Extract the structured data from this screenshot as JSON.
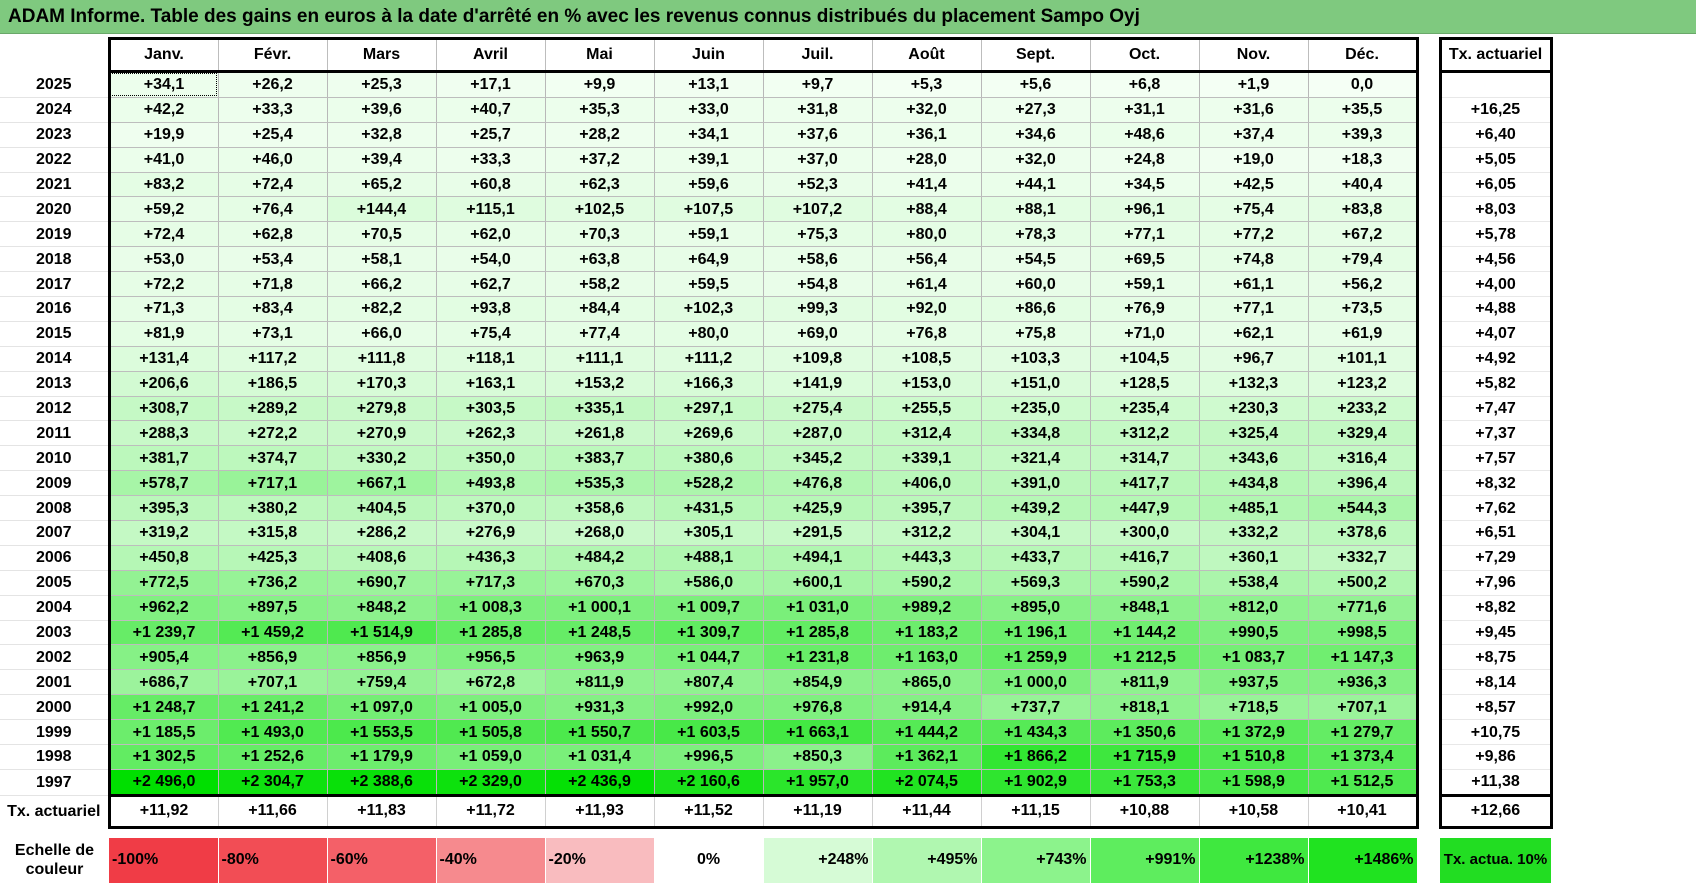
{
  "title": "ADAM Informe. Table des gains en euros à la date d'arrêté en % avec les revenus connus distribués du placement Sampo Oyj",
  "months": [
    "Janv.",
    "Févr.",
    "Mars",
    "Avril",
    "Mai",
    "Juin",
    "Juil.",
    "Août",
    "Sept.",
    "Oct.",
    "Nov.",
    "Déc."
  ],
  "actuarial_header": "Tx. actuariel",
  "rows": [
    {
      "year": "2025",
      "values": [
        "+34,1",
        "+26,2",
        "+25,3",
        "+17,1",
        "+9,9",
        "+13,1",
        "+9,7",
        "+5,3",
        "+5,6",
        "+6,8",
        "+1,9",
        "0,0"
      ],
      "rate": ""
    },
    {
      "year": "2024",
      "values": [
        "+42,2",
        "+33,3",
        "+39,6",
        "+40,7",
        "+35,3",
        "+33,0",
        "+31,8",
        "+32,0",
        "+27,3",
        "+31,1",
        "+31,6",
        "+35,5"
      ],
      "rate": "+16,25"
    },
    {
      "year": "2023",
      "values": [
        "+19,9",
        "+25,4",
        "+32,8",
        "+25,7",
        "+28,2",
        "+34,1",
        "+37,6",
        "+36,1",
        "+34,6",
        "+48,6",
        "+37,4",
        "+39,3"
      ],
      "rate": "+6,40"
    },
    {
      "year": "2022",
      "values": [
        "+41,0",
        "+46,0",
        "+39,4",
        "+33,3",
        "+37,2",
        "+39,1",
        "+37,0",
        "+28,0",
        "+32,0",
        "+24,8",
        "+19,0",
        "+18,3"
      ],
      "rate": "+5,05"
    },
    {
      "year": "2021",
      "values": [
        "+83,2",
        "+72,4",
        "+65,2",
        "+60,8",
        "+62,3",
        "+59,6",
        "+52,3",
        "+41,4",
        "+44,1",
        "+34,5",
        "+42,5",
        "+40,4"
      ],
      "rate": "+6,05"
    },
    {
      "year": "2020",
      "values": [
        "+59,2",
        "+76,4",
        "+144,4",
        "+115,1",
        "+102,5",
        "+107,5",
        "+107,2",
        "+88,4",
        "+88,1",
        "+96,1",
        "+75,4",
        "+83,8"
      ],
      "rate": "+8,03"
    },
    {
      "year": "2019",
      "values": [
        "+72,4",
        "+62,8",
        "+70,5",
        "+62,0",
        "+70,3",
        "+59,1",
        "+75,3",
        "+80,0",
        "+78,3",
        "+77,1",
        "+77,2",
        "+67,2"
      ],
      "rate": "+5,78"
    },
    {
      "year": "2018",
      "values": [
        "+53,0",
        "+53,4",
        "+58,1",
        "+54,0",
        "+63,8",
        "+64,9",
        "+58,6",
        "+56,4",
        "+54,5",
        "+69,5",
        "+74,8",
        "+79,4"
      ],
      "rate": "+4,56"
    },
    {
      "year": "2017",
      "values": [
        "+72,2",
        "+71,8",
        "+66,2",
        "+62,7",
        "+58,2",
        "+59,5",
        "+54,8",
        "+61,4",
        "+60,0",
        "+59,1",
        "+61,1",
        "+56,2"
      ],
      "rate": "+4,00"
    },
    {
      "year": "2016",
      "values": [
        "+71,3",
        "+83,4",
        "+82,2",
        "+93,8",
        "+84,4",
        "+102,3",
        "+99,3",
        "+92,0",
        "+86,6",
        "+76,9",
        "+77,1",
        "+73,5"
      ],
      "rate": "+4,88"
    },
    {
      "year": "2015",
      "values": [
        "+81,9",
        "+73,1",
        "+66,0",
        "+75,4",
        "+77,4",
        "+80,0",
        "+69,0",
        "+76,8",
        "+75,8",
        "+71,0",
        "+62,1",
        "+61,9"
      ],
      "rate": "+4,07"
    },
    {
      "year": "2014",
      "values": [
        "+131,4",
        "+117,2",
        "+111,8",
        "+118,1",
        "+111,1",
        "+111,2",
        "+109,8",
        "+108,5",
        "+103,3",
        "+104,5",
        "+96,7",
        "+101,1"
      ],
      "rate": "+4,92"
    },
    {
      "year": "2013",
      "values": [
        "+206,6",
        "+186,5",
        "+170,3",
        "+163,1",
        "+153,2",
        "+166,3",
        "+141,9",
        "+153,0",
        "+151,0",
        "+128,5",
        "+132,3",
        "+123,2"
      ],
      "rate": "+5,82"
    },
    {
      "year": "2012",
      "values": [
        "+308,7",
        "+289,2",
        "+279,8",
        "+303,5",
        "+335,1",
        "+297,1",
        "+275,4",
        "+255,5",
        "+235,0",
        "+235,4",
        "+230,3",
        "+233,2"
      ],
      "rate": "+7,47"
    },
    {
      "year": "2011",
      "values": [
        "+288,3",
        "+272,2",
        "+270,9",
        "+262,3",
        "+261,8",
        "+269,6",
        "+287,0",
        "+312,4",
        "+334,8",
        "+312,2",
        "+325,4",
        "+329,4"
      ],
      "rate": "+7,37"
    },
    {
      "year": "2010",
      "values": [
        "+381,7",
        "+374,7",
        "+330,2",
        "+350,0",
        "+383,7",
        "+380,6",
        "+345,2",
        "+339,1",
        "+321,4",
        "+314,7",
        "+343,6",
        "+316,4"
      ],
      "rate": "+7,57"
    },
    {
      "year": "2009",
      "values": [
        "+578,7",
        "+717,1",
        "+667,1",
        "+493,8",
        "+535,3",
        "+528,2",
        "+476,8",
        "+406,0",
        "+391,0",
        "+417,7",
        "+434,8",
        "+396,4"
      ],
      "rate": "+8,32"
    },
    {
      "year": "2008",
      "values": [
        "+395,3",
        "+380,2",
        "+404,5",
        "+370,0",
        "+358,6",
        "+431,5",
        "+425,9",
        "+395,7",
        "+439,2",
        "+447,9",
        "+485,1",
        "+544,3"
      ],
      "rate": "+7,62"
    },
    {
      "year": "2007",
      "values": [
        "+319,2",
        "+315,8",
        "+286,2",
        "+276,9",
        "+268,0",
        "+305,1",
        "+291,5",
        "+312,2",
        "+304,1",
        "+300,0",
        "+332,2",
        "+378,6"
      ],
      "rate": "+6,51"
    },
    {
      "year": "2006",
      "values": [
        "+450,8",
        "+425,3",
        "+408,6",
        "+436,3",
        "+484,2",
        "+488,1",
        "+494,1",
        "+443,3",
        "+433,7",
        "+416,7",
        "+360,1",
        "+332,7"
      ],
      "rate": "+7,29"
    },
    {
      "year": "2005",
      "values": [
        "+772,5",
        "+736,2",
        "+690,7",
        "+717,3",
        "+670,3",
        "+586,0",
        "+600,1",
        "+590,2",
        "+569,3",
        "+590,2",
        "+538,4",
        "+500,2"
      ],
      "rate": "+7,96"
    },
    {
      "year": "2004",
      "values": [
        "+962,2",
        "+897,5",
        "+848,2",
        "+1 008,3",
        "+1 000,1",
        "+1 009,7",
        "+1 031,0",
        "+989,2",
        "+895,0",
        "+848,1",
        "+812,0",
        "+771,6"
      ],
      "rate": "+8,82"
    },
    {
      "year": "2003",
      "values": [
        "+1 239,7",
        "+1 459,2",
        "+1 514,9",
        "+1 285,8",
        "+1 248,5",
        "+1 309,7",
        "+1 285,8",
        "+1 183,2",
        "+1 196,1",
        "+1 144,2",
        "+990,5",
        "+998,5"
      ],
      "rate": "+9,45"
    },
    {
      "year": "2002",
      "values": [
        "+905,4",
        "+856,9",
        "+856,9",
        "+956,5",
        "+963,9",
        "+1 044,7",
        "+1 231,8",
        "+1 163,0",
        "+1 259,9",
        "+1 212,5",
        "+1 083,7",
        "+1 147,3"
      ],
      "rate": "+8,75"
    },
    {
      "year": "2001",
      "values": [
        "+686,7",
        "+707,1",
        "+759,4",
        "+672,8",
        "+811,9",
        "+807,4",
        "+854,9",
        "+865,0",
        "+1 000,0",
        "+811,9",
        "+937,5",
        "+936,3"
      ],
      "rate": "+8,14"
    },
    {
      "year": "2000",
      "values": [
        "+1 248,7",
        "+1 241,2",
        "+1 097,0",
        "+1 005,0",
        "+931,3",
        "+992,0",
        "+976,8",
        "+914,4",
        "+737,7",
        "+818,1",
        "+718,5",
        "+707,1"
      ],
      "rate": "+8,57"
    },
    {
      "year": "1999",
      "values": [
        "+1 185,5",
        "+1 493,0",
        "+1 553,5",
        "+1 505,8",
        "+1 550,7",
        "+1 603,5",
        "+1 663,1",
        "+1 444,2",
        "+1 434,3",
        "+1 350,6",
        "+1 372,9",
        "+1 279,7"
      ],
      "rate": "+10,75"
    },
    {
      "year": "1998",
      "values": [
        "+1 302,5",
        "+1 252,6",
        "+1 179,9",
        "+1 059,0",
        "+1 031,4",
        "+996,5",
        "+850,3",
        "+1 362,1",
        "+1 866,2",
        "+1 715,9",
        "+1 510,8",
        "+1 373,4"
      ],
      "rate": "+9,86"
    },
    {
      "year": "1997",
      "values": [
        "+2 496,0",
        "+2 304,7",
        "+2 388,6",
        "+2 329,0",
        "+2 436,9",
        "+2 160,6",
        "+1 957,0",
        "+2 074,5",
        "+1 902,9",
        "+1 753,3",
        "+1 598,9",
        "+1 512,5"
      ],
      "rate": "+11,38"
    }
  ],
  "tx_row": {
    "label": "Tx. actuariel",
    "values": [
      "+11,92",
      "+11,66",
      "+11,83",
      "+11,72",
      "+11,93",
      "+11,52",
      "+11,19",
      "+11,44",
      "+11,15",
      "+10,88",
      "+10,58",
      "+10,41"
    ],
    "total": "+12,66"
  },
  "scale": {
    "label": "Echelle de couleur",
    "items": [
      {
        "text": "-100%",
        "color": "#f03c46",
        "align": "left"
      },
      {
        "text": "-80%",
        "color": "#f24d55",
        "align": "left"
      },
      {
        "text": "-60%",
        "color": "#f46068",
        "align": "left"
      },
      {
        "text": "-40%",
        "color": "#f68a8e",
        "align": "left"
      },
      {
        "text": "-20%",
        "color": "#f9bcbf",
        "align": "left"
      },
      {
        "text": "0%",
        "color": "#ffffff",
        "align": "center"
      },
      {
        "text": "+248%",
        "color": "#d6fbd6",
        "align": "right"
      },
      {
        "text": "+495%",
        "color": "#b0f7b0",
        "align": "right"
      },
      {
        "text": "+743%",
        "color": "#8cf38c",
        "align": "right"
      },
      {
        "text": "+991%",
        "color": "#5eed5e",
        "align": "right"
      },
      {
        "text": "+1238%",
        "color": "#3fe83f",
        "align": "right"
      },
      {
        "text": "+1486%",
        "color": "#20e320",
        "align": "right"
      }
    ],
    "actuarial": {
      "text": "Tx. actua. 10%",
      "color": "#22dd22"
    }
  },
  "colors": {
    "title_bg": "#7fc97f",
    "scale_max_green": "#00df00",
    "base_green": "#f2fef2"
  }
}
